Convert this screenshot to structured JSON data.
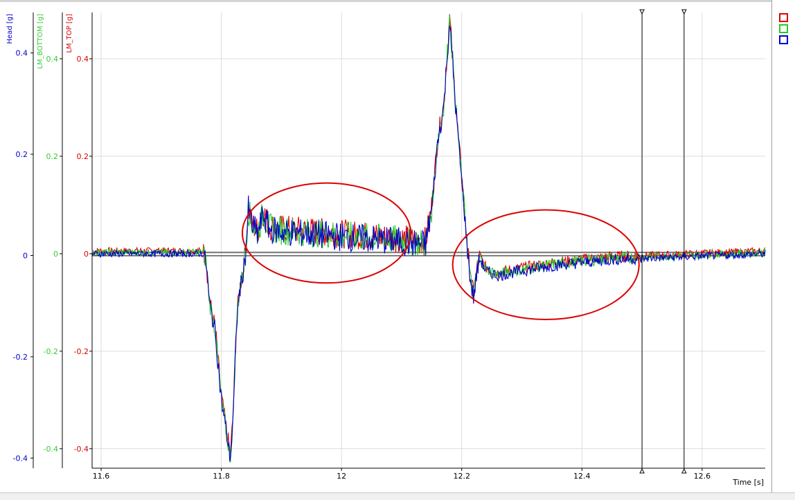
{
  "chart_data": {
    "type": "line",
    "x_axis": {
      "label": "Time [s]",
      "ticks": [
        "11.6",
        "11.8",
        "12",
        "12.2",
        "12.4",
        "12.6"
      ],
      "tick_values": [
        11.6,
        11.8,
        12.0,
        12.2,
        12.4,
        12.6
      ],
      "range": [
        11.585,
        12.705
      ]
    },
    "y_axes": [
      {
        "name": "Head [g]",
        "color": "#0000cc",
        "ticks": [
          "0.4",
          "0.2",
          "0",
          "-0.2",
          "-0.4"
        ],
        "tick_values": [
          0.4,
          0.2,
          0.0,
          -0.2,
          -0.4
        ],
        "range": [
          -0.42,
          0.48
        ]
      },
      {
        "name": "LM_BOTTOM [g]",
        "color": "#33cc33",
        "ticks": [
          "0.4",
          "0.2",
          "0",
          "-0.2",
          "-0.4"
        ],
        "tick_values": [
          0.4,
          0.2,
          0.0,
          -0.2,
          -0.4
        ],
        "range": [
          -0.44,
          0.495
        ]
      },
      {
        "name": "LM_TOP [g]",
        "color": "#dd0000",
        "ticks": [
          "0.4",
          "0.2",
          "0",
          "-0.2",
          "-0.4"
        ],
        "tick_values": [
          0.4,
          0.2,
          0.0,
          -0.2,
          -0.4
        ],
        "range": [
          -0.44,
          0.495
        ]
      }
    ],
    "series": [
      {
        "color": "#dd0000"
      },
      {
        "color": "#22cc22"
      },
      {
        "color": "#0000cc"
      }
    ],
    "shape_points": [
      [
        11.585,
        0.0
      ],
      [
        11.77,
        0.0
      ],
      [
        11.775,
        -0.02
      ],
      [
        11.78,
        -0.1
      ],
      [
        11.79,
        -0.16
      ],
      [
        11.8,
        -0.3
      ],
      [
        11.81,
        -0.38
      ],
      [
        11.815,
        -0.42
      ],
      [
        11.82,
        -0.33
      ],
      [
        11.825,
        -0.15
      ],
      [
        11.83,
        -0.08
      ],
      [
        11.835,
        -0.05
      ],
      [
        11.84,
        0.0
      ],
      [
        11.845,
        0.09
      ],
      [
        11.85,
        0.06
      ],
      [
        11.86,
        0.04
      ],
      [
        11.87,
        0.08
      ],
      [
        11.88,
        0.05
      ],
      [
        11.9,
        0.045
      ],
      [
        11.95,
        0.04
      ],
      [
        12.0,
        0.035
      ],
      [
        12.05,
        0.03
      ],
      [
        12.1,
        0.025
      ],
      [
        12.13,
        0.02
      ],
      [
        12.14,
        0.02
      ],
      [
        12.15,
        0.09
      ],
      [
        12.16,
        0.23
      ],
      [
        12.17,
        0.3
      ],
      [
        12.18,
        0.48
      ],
      [
        12.19,
        0.3
      ],
      [
        12.2,
        0.15
      ],
      [
        12.205,
        0.08
      ],
      [
        12.21,
        0.0
      ],
      [
        12.215,
        -0.06
      ],
      [
        12.22,
        -0.09
      ],
      [
        12.225,
        -0.04
      ],
      [
        12.23,
        -0.01
      ],
      [
        12.24,
        -0.035
      ],
      [
        12.26,
        -0.045
      ],
      [
        12.3,
        -0.035
      ],
      [
        12.35,
        -0.025
      ],
      [
        12.4,
        -0.018
      ],
      [
        12.45,
        -0.012
      ],
      [
        12.5,
        -0.01
      ],
      [
        12.55,
        -0.008
      ],
      [
        12.6,
        -0.005
      ],
      [
        12.65,
        -0.003
      ],
      [
        12.705,
        0.0
      ]
    ],
    "cursors": [
      12.5,
      12.57
    ],
    "zero_line": 0.0,
    "annotations": [
      {
        "type": "ellipse-mark",
        "x_range": [
          11.835,
          12.115
        ],
        "y_range": [
          -0.06,
          0.145
        ],
        "color": "#dd0000"
      },
      {
        "type": "ellipse-mark",
        "x_range": [
          12.185,
          12.495
        ],
        "y_range": [
          -0.135,
          0.09
        ],
        "color": "#dd0000"
      }
    ],
    "grid": true,
    "legend": "right-side"
  },
  "legend": {
    "items": [
      {
        "color": "#dd0000"
      },
      {
        "color": "#22cc22"
      },
      {
        "color": "#0000cc"
      }
    ]
  }
}
